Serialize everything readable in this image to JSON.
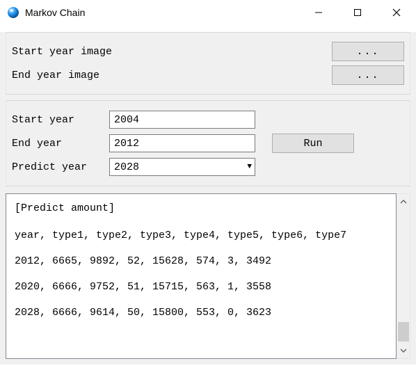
{
  "window": {
    "title": "Markov Chain"
  },
  "file_section": {
    "start_image_label": "Start year image",
    "end_image_label": "End year image",
    "browse_label": "..."
  },
  "params": {
    "start_year_label": "Start year",
    "start_year_value": "2004",
    "end_year_label": "End year",
    "end_year_value": "2012",
    "run_label": "Run",
    "predict_year_label": "Predict year",
    "predict_year_value": "2028"
  },
  "output": {
    "header": "[Predict amount]",
    "columns": "year, type1, type2, type3, type4, type5, type6, type7",
    "rows": [
      "2012, 6665, 9892, 52, 15628, 574, 3, 3492",
      "2020, 6666, 9752, 51, 15715, 563, 1, 3558",
      "2028, 6666, 9614, 50, 15800, 553, 0, 3623"
    ]
  }
}
